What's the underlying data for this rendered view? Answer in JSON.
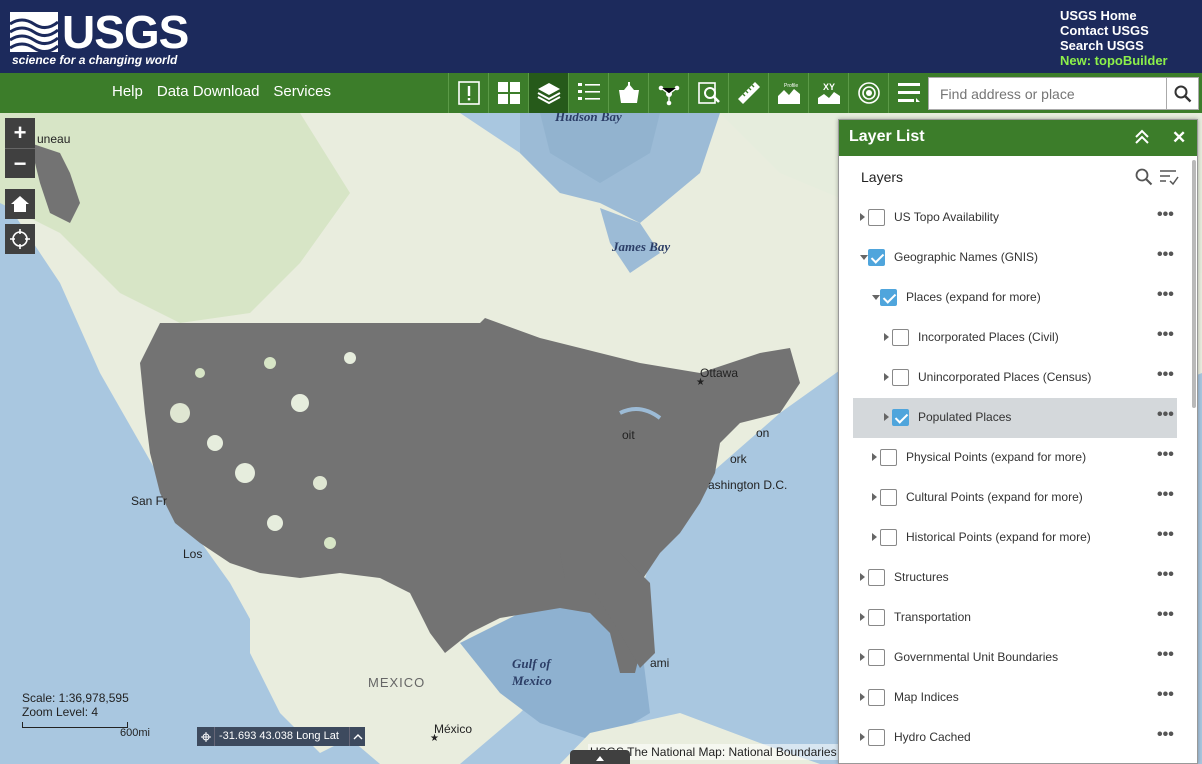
{
  "header": {
    "logo_word": "USGS",
    "logo_tagline": "science for a changing world",
    "links": [
      "USGS Home",
      "Contact USGS",
      "Search USGS"
    ],
    "new_link": "New: topoBuilder"
  },
  "toolbar": {
    "nav": [
      "Help",
      "Data Download",
      "Services"
    ],
    "tools": [
      {
        "icon": "alert-icon",
        "active": false
      },
      {
        "icon": "grid-icon",
        "active": false
      },
      {
        "icon": "layers-icon",
        "active": true
      },
      {
        "icon": "legend-list-icon",
        "active": false
      },
      {
        "icon": "basemap-icon",
        "active": false
      },
      {
        "icon": "share-icon",
        "active": false
      },
      {
        "icon": "query-icon",
        "active": false
      },
      {
        "icon": "measure-ruler-icon",
        "active": false
      },
      {
        "icon": "profile-icon",
        "active": false
      },
      {
        "icon": "xy-icon",
        "active": false
      },
      {
        "icon": "radio-target-icon",
        "active": false
      },
      {
        "icon": "menu-more-icon",
        "active": false
      }
    ],
    "tool_labels": {
      "profile": "Profile",
      "xy": "XY"
    },
    "search_placeholder": "Find address or place"
  },
  "map": {
    "labels": {
      "hudson_bay": "Hudson Bay",
      "james_bay": "James Bay",
      "gulf_line1": "Gulf of",
      "gulf_line2": "Mexico",
      "ottawa": "Ottawa",
      "washington": "ashington D.C.",
      "san_fr": "San Fr",
      "los": "Los",
      "juneau": "uneau",
      "mexico_country": "MEXICO",
      "mexico_city": "México",
      "miami": "ami",
      "toronto_frag": "oit",
      "boston_frag": "on",
      "ny_frag": "ork"
    },
    "scale_text": "Scale: 1:36,978,595",
    "zoom_text": "Zoom Level: 4",
    "scale_unit": "600mi",
    "coords": "-31.693 43.038 Long Lat",
    "attribution": "USGS The National Map: National Boundaries Dataset"
  },
  "layer_panel": {
    "title": "Layer List",
    "section": "Layers",
    "layers": [
      {
        "label": "US Topo Availability",
        "level": 0,
        "checked": false,
        "expanded": false,
        "selected": false
      },
      {
        "label": "Geographic Names (GNIS)",
        "level": 0,
        "checked": true,
        "expanded": true,
        "selected": false
      },
      {
        "label": "Places (expand for more)",
        "level": 1,
        "checked": true,
        "expanded": true,
        "selected": false
      },
      {
        "label": "Incorporated Places (Civil)",
        "level": 2,
        "checked": false,
        "expanded": false,
        "selected": false
      },
      {
        "label": "Unincorporated Places (Census)",
        "level": 2,
        "checked": false,
        "expanded": false,
        "selected": false
      },
      {
        "label": "Populated Places",
        "level": 2,
        "checked": true,
        "expanded": false,
        "selected": true
      },
      {
        "label": "Physical Points (expand for more)",
        "level": 1,
        "checked": false,
        "expanded": false,
        "selected": false
      },
      {
        "label": "Cultural Points (expand for more)",
        "level": 1,
        "checked": false,
        "expanded": false,
        "selected": false
      },
      {
        "label": "Historical Points (expand for more)",
        "level": 1,
        "checked": false,
        "expanded": false,
        "selected": false
      },
      {
        "label": "Structures",
        "level": 0,
        "checked": false,
        "expanded": false,
        "selected": false
      },
      {
        "label": "Transportation",
        "level": 0,
        "checked": false,
        "expanded": false,
        "selected": false
      },
      {
        "label": "Governmental Unit Boundaries",
        "level": 0,
        "checked": false,
        "expanded": false,
        "selected": false
      },
      {
        "label": "Map Indices",
        "level": 0,
        "checked": false,
        "expanded": false,
        "selected": false
      },
      {
        "label": "Hydro Cached",
        "level": 0,
        "checked": false,
        "expanded": false,
        "selected": false
      }
    ]
  },
  "colors": {
    "header_bg": "#1c2a5c",
    "toolbar_bg": "#3c7d2a",
    "accent_new": "#8cf04a",
    "checkbox_on": "#4fa5dc",
    "overlay_gray": "#737373"
  }
}
